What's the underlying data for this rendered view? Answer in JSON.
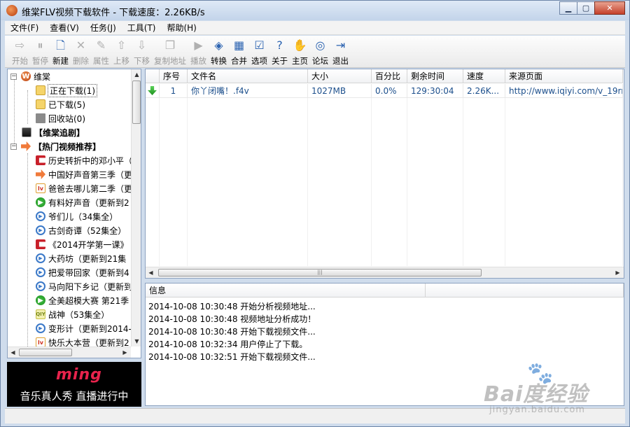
{
  "window": {
    "title": "维棠FLV视频下载软件 - 下载速度：2.26KB/s"
  },
  "menu": [
    "文件(F)",
    "查看(V)",
    "任务(J)",
    "工具(T)",
    "帮助(H)"
  ],
  "toolbar": [
    {
      "label": "开始",
      "icon": "play-icon",
      "glyph": "⇨",
      "disabled": true
    },
    {
      "label": "暂停",
      "icon": "pause-icon",
      "glyph": "⏸",
      "disabled": true
    },
    {
      "label": "新建",
      "icon": "new-file-icon",
      "glyph": "🗋",
      "disabled": false
    },
    {
      "label": "删除",
      "icon": "delete-icon",
      "glyph": "✕",
      "disabled": true
    },
    {
      "label": "属性",
      "icon": "properties-icon",
      "glyph": "✎",
      "disabled": true
    },
    {
      "label": "上移",
      "icon": "move-up-icon",
      "glyph": "⇧",
      "disabled": true
    },
    {
      "label": "下移",
      "icon": "move-down-icon",
      "glyph": "⇩",
      "disabled": true
    },
    {
      "label": "复制地址",
      "icon": "copy-address-icon",
      "glyph": "❐",
      "disabled": true
    },
    {
      "label": "播放",
      "icon": "playback-icon",
      "glyph": "▶",
      "disabled": true
    },
    {
      "label": "转换",
      "icon": "convert-icon",
      "glyph": "◈",
      "disabled": false
    },
    {
      "label": "合并",
      "icon": "merge-icon",
      "glyph": "▦",
      "disabled": false
    },
    {
      "label": "选项",
      "icon": "options-icon",
      "glyph": "☑",
      "disabled": false
    },
    {
      "label": "关于",
      "icon": "about-icon",
      "glyph": "?",
      "disabled": false
    },
    {
      "label": "主页",
      "icon": "homepage-icon",
      "glyph": "✋",
      "disabled": false
    },
    {
      "label": "论坛",
      "icon": "forum-icon",
      "glyph": "◎",
      "disabled": false
    },
    {
      "label": "退出",
      "icon": "exit-icon",
      "glyph": "⇥",
      "disabled": false
    }
  ],
  "tree": {
    "root": "维棠",
    "downloading": "正在下载(1)",
    "downloaded": "已下载(5)",
    "recycle": "回收站(0)",
    "drama": "【维棠追剧】",
    "hot": "【热门视频推荐】",
    "hot_items": [
      {
        "label": "历史转折中的邓小平（",
        "icon": "red-bar-icon"
      },
      {
        "label": "中国好声音第三季（更",
        "icon": "orange-arrow-icon"
      },
      {
        "label": "爸爸去哪儿第二季（更",
        "icon": "letv-icon"
      },
      {
        "label": "有料好声音（更新到2",
        "icon": "green-play-icon"
      },
      {
        "label": "爷们儿（34集全）",
        "icon": "blue-play-icon"
      },
      {
        "label": "古剑奇谭（52集全）",
        "icon": "blue-play-icon"
      },
      {
        "label": "《2014开学第一课》",
        "icon": "red-bar-icon"
      },
      {
        "label": "大药坊（更新到21集",
        "icon": "blue-play-icon"
      },
      {
        "label": "把爱带回家（更新到4",
        "icon": "blue-play-icon"
      },
      {
        "label": "马向阳下乡记（更新到",
        "icon": "blue-play-icon"
      },
      {
        "label": "全美超模大赛 第21季",
        "icon": "green-play-icon"
      },
      {
        "label": "战神（53集全）",
        "icon": "iqiyi-icon"
      },
      {
        "label": "变形计（更新到2014-",
        "icon": "blue-play-icon"
      },
      {
        "label": "快乐大本营（更新到2",
        "icon": "letv-icon"
      }
    ]
  },
  "ad": {
    "logo": "ming",
    "text": "音乐真人秀 直播进行中"
  },
  "grid": {
    "columns": [
      "",
      "序号",
      "文件名",
      "大小",
      "百分比",
      "剩余时间",
      "速度",
      "来源页面"
    ],
    "rows": [
      [
        "",
        "1",
        "你丫闭嘴！.f4v",
        "1027MB",
        "0.0%",
        "129:30:04",
        "2.26K...",
        "http://www.iqiyi.com/v_19rrh"
      ]
    ]
  },
  "info": {
    "header": "信息",
    "lines": [
      "2014-10-08 10:30:48 开始分析视频地址...",
      "2014-10-08 10:30:48 视频地址分析成功！",
      "2014-10-08 10:30:48 开始下载视频文件...",
      "2014-10-08 10:32:34 用户停止了下载。",
      "2014-10-08 10:32:51 开始下载视频文件..."
    ]
  },
  "watermark": {
    "brand": "Bai度经验",
    "url": "jingyan.baidu.com"
  },
  "colors": {
    "selection_blue": "#1c4f8c",
    "titlebar": "#c3d4ea",
    "close_button": "#c4402a"
  }
}
